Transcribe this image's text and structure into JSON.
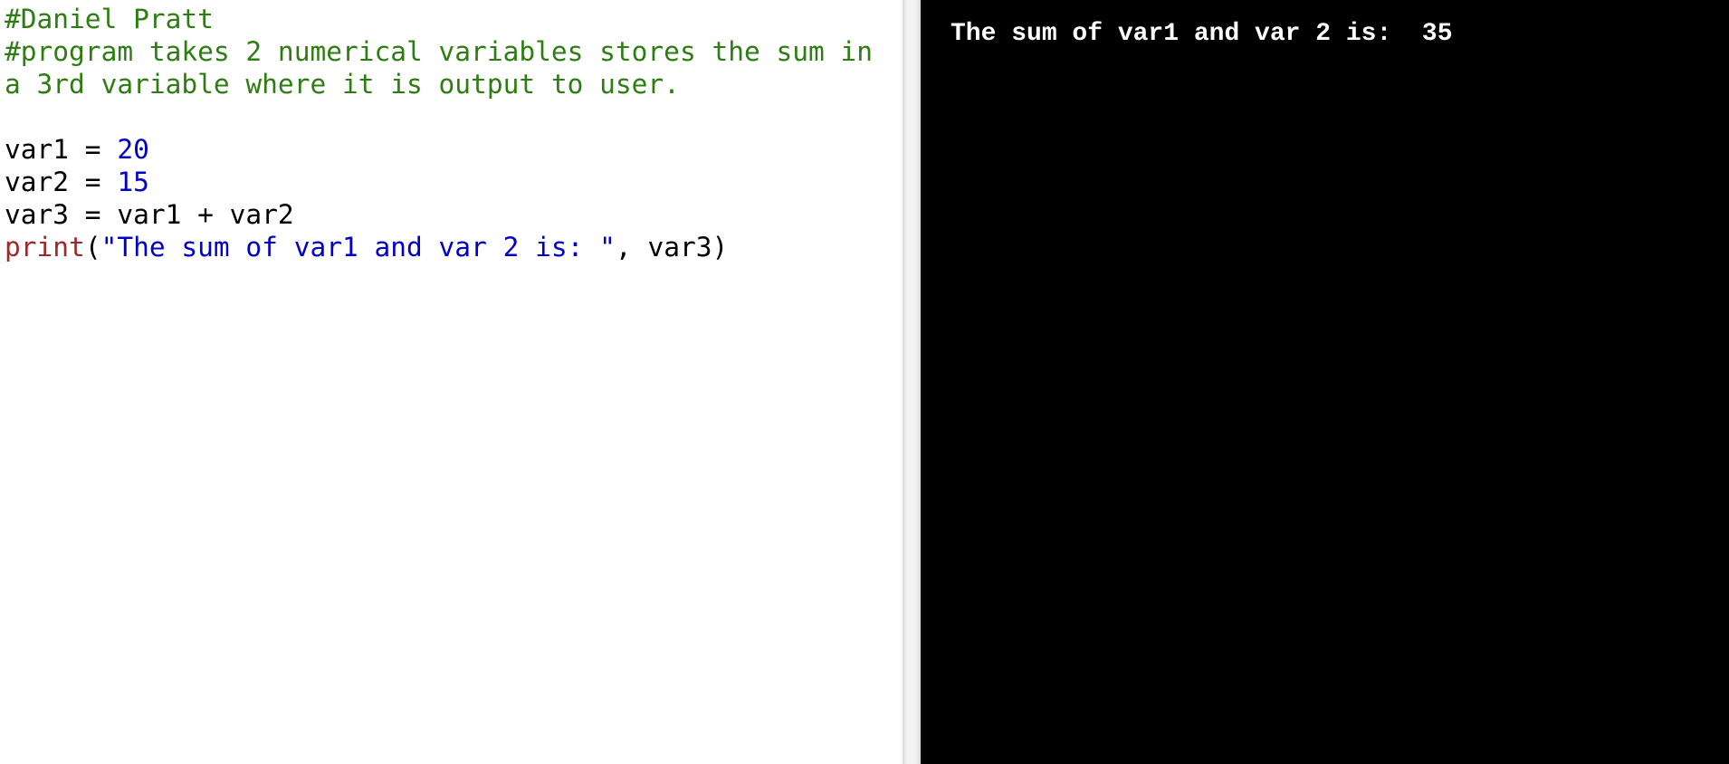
{
  "editor": {
    "lines": [
      [
        {
          "cls": "tok-comment",
          "text": "#Daniel Pratt"
        }
      ],
      [
        {
          "cls": "tok-comment",
          "text": "#program takes 2 numerical variables stores the sum in"
        }
      ],
      [
        {
          "cls": "tok-comment",
          "text": "a 3rd variable where it is output to user."
        }
      ],
      [
        {
          "cls": "tok-plain",
          "text": ""
        }
      ],
      [
        {
          "cls": "tok-plain",
          "text": "var1 = "
        },
        {
          "cls": "tok-number",
          "text": "20"
        }
      ],
      [
        {
          "cls": "tok-plain",
          "text": "var2 = "
        },
        {
          "cls": "tok-number",
          "text": "15"
        }
      ],
      [
        {
          "cls": "tok-plain",
          "text": "var3 = var1 + var2"
        }
      ],
      [
        {
          "cls": "tok-builtin",
          "text": "print"
        },
        {
          "cls": "tok-plain",
          "text": "("
        },
        {
          "cls": "tok-string",
          "text": "\"The sum of var1 and var 2 is: \""
        },
        {
          "cls": "tok-plain",
          "text": ", var3)"
        }
      ]
    ]
  },
  "console": {
    "output": "The sum of var1 and var 2 is:  35"
  },
  "colors": {
    "comment": "#2e7d13",
    "number": "#0000c8",
    "string": "#0000c8",
    "builtin": "#9b2a2a",
    "console_bg": "#000000",
    "console_fg": "#ffffff"
  }
}
